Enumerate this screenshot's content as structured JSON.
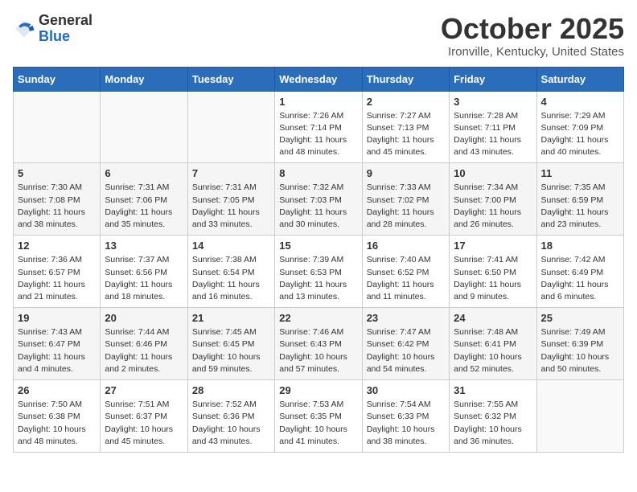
{
  "header": {
    "logo_general": "General",
    "logo_blue": "Blue",
    "month_title": "October 2025",
    "location": "Ironville, Kentucky, United States"
  },
  "days_of_week": [
    "Sunday",
    "Monday",
    "Tuesday",
    "Wednesday",
    "Thursday",
    "Friday",
    "Saturday"
  ],
  "weeks": [
    {
      "days": [
        {
          "number": "",
          "info": ""
        },
        {
          "number": "",
          "info": ""
        },
        {
          "number": "",
          "info": ""
        },
        {
          "number": "1",
          "info": "Sunrise: 7:26 AM\nSunset: 7:14 PM\nDaylight: 11 hours and 48 minutes."
        },
        {
          "number": "2",
          "info": "Sunrise: 7:27 AM\nSunset: 7:13 PM\nDaylight: 11 hours and 45 minutes."
        },
        {
          "number": "3",
          "info": "Sunrise: 7:28 AM\nSunset: 7:11 PM\nDaylight: 11 hours and 43 minutes."
        },
        {
          "number": "4",
          "info": "Sunrise: 7:29 AM\nSunset: 7:09 PM\nDaylight: 11 hours and 40 minutes."
        }
      ]
    },
    {
      "days": [
        {
          "number": "5",
          "info": "Sunrise: 7:30 AM\nSunset: 7:08 PM\nDaylight: 11 hours and 38 minutes."
        },
        {
          "number": "6",
          "info": "Sunrise: 7:31 AM\nSunset: 7:06 PM\nDaylight: 11 hours and 35 minutes."
        },
        {
          "number": "7",
          "info": "Sunrise: 7:31 AM\nSunset: 7:05 PM\nDaylight: 11 hours and 33 minutes."
        },
        {
          "number": "8",
          "info": "Sunrise: 7:32 AM\nSunset: 7:03 PM\nDaylight: 11 hours and 30 minutes."
        },
        {
          "number": "9",
          "info": "Sunrise: 7:33 AM\nSunset: 7:02 PM\nDaylight: 11 hours and 28 minutes."
        },
        {
          "number": "10",
          "info": "Sunrise: 7:34 AM\nSunset: 7:00 PM\nDaylight: 11 hours and 26 minutes."
        },
        {
          "number": "11",
          "info": "Sunrise: 7:35 AM\nSunset: 6:59 PM\nDaylight: 11 hours and 23 minutes."
        }
      ]
    },
    {
      "days": [
        {
          "number": "12",
          "info": "Sunrise: 7:36 AM\nSunset: 6:57 PM\nDaylight: 11 hours and 21 minutes."
        },
        {
          "number": "13",
          "info": "Sunrise: 7:37 AM\nSunset: 6:56 PM\nDaylight: 11 hours and 18 minutes."
        },
        {
          "number": "14",
          "info": "Sunrise: 7:38 AM\nSunset: 6:54 PM\nDaylight: 11 hours and 16 minutes."
        },
        {
          "number": "15",
          "info": "Sunrise: 7:39 AM\nSunset: 6:53 PM\nDaylight: 11 hours and 13 minutes."
        },
        {
          "number": "16",
          "info": "Sunrise: 7:40 AM\nSunset: 6:52 PM\nDaylight: 11 hours and 11 minutes."
        },
        {
          "number": "17",
          "info": "Sunrise: 7:41 AM\nSunset: 6:50 PM\nDaylight: 11 hours and 9 minutes."
        },
        {
          "number": "18",
          "info": "Sunrise: 7:42 AM\nSunset: 6:49 PM\nDaylight: 11 hours and 6 minutes."
        }
      ]
    },
    {
      "days": [
        {
          "number": "19",
          "info": "Sunrise: 7:43 AM\nSunset: 6:47 PM\nDaylight: 11 hours and 4 minutes."
        },
        {
          "number": "20",
          "info": "Sunrise: 7:44 AM\nSunset: 6:46 PM\nDaylight: 11 hours and 2 minutes."
        },
        {
          "number": "21",
          "info": "Sunrise: 7:45 AM\nSunset: 6:45 PM\nDaylight: 10 hours and 59 minutes."
        },
        {
          "number": "22",
          "info": "Sunrise: 7:46 AM\nSunset: 6:43 PM\nDaylight: 10 hours and 57 minutes."
        },
        {
          "number": "23",
          "info": "Sunrise: 7:47 AM\nSunset: 6:42 PM\nDaylight: 10 hours and 54 minutes."
        },
        {
          "number": "24",
          "info": "Sunrise: 7:48 AM\nSunset: 6:41 PM\nDaylight: 10 hours and 52 minutes."
        },
        {
          "number": "25",
          "info": "Sunrise: 7:49 AM\nSunset: 6:39 PM\nDaylight: 10 hours and 50 minutes."
        }
      ]
    },
    {
      "days": [
        {
          "number": "26",
          "info": "Sunrise: 7:50 AM\nSunset: 6:38 PM\nDaylight: 10 hours and 48 minutes."
        },
        {
          "number": "27",
          "info": "Sunrise: 7:51 AM\nSunset: 6:37 PM\nDaylight: 10 hours and 45 minutes."
        },
        {
          "number": "28",
          "info": "Sunrise: 7:52 AM\nSunset: 6:36 PM\nDaylight: 10 hours and 43 minutes."
        },
        {
          "number": "29",
          "info": "Sunrise: 7:53 AM\nSunset: 6:35 PM\nDaylight: 10 hours and 41 minutes."
        },
        {
          "number": "30",
          "info": "Sunrise: 7:54 AM\nSunset: 6:33 PM\nDaylight: 10 hours and 38 minutes."
        },
        {
          "number": "31",
          "info": "Sunrise: 7:55 AM\nSunset: 6:32 PM\nDaylight: 10 hours and 36 minutes."
        },
        {
          "number": "",
          "info": ""
        }
      ]
    }
  ]
}
